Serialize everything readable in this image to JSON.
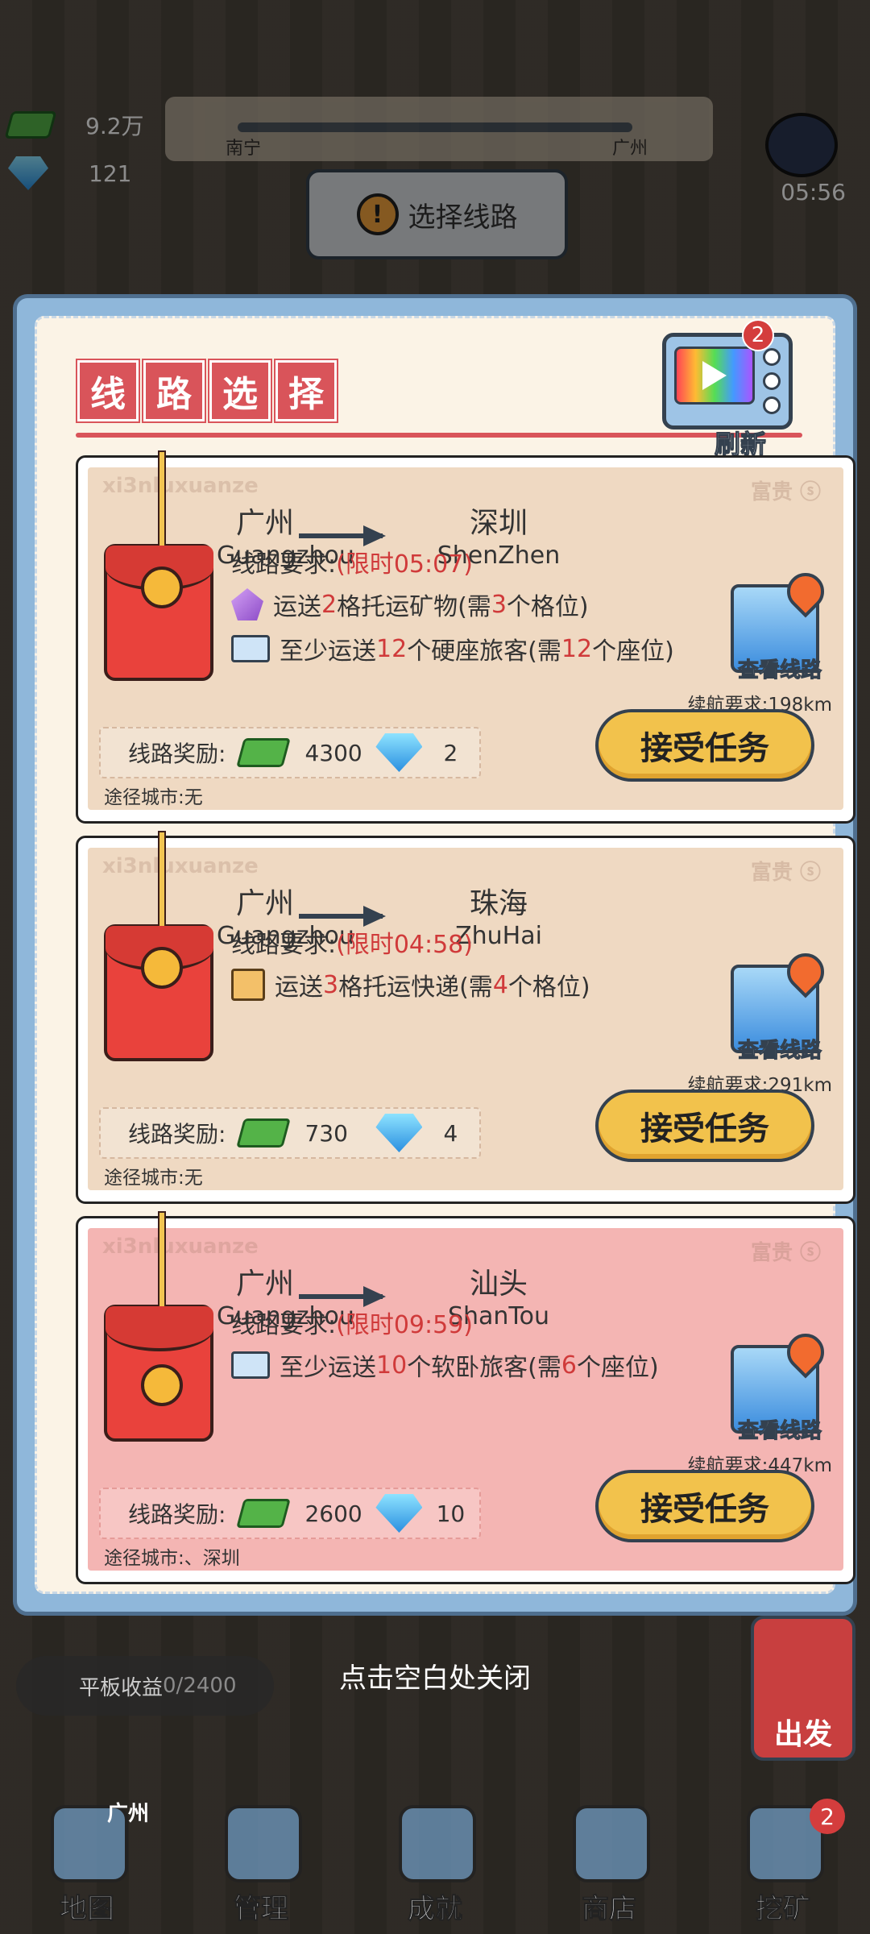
{
  "hud": {
    "cash": "9.2万",
    "gems": "121",
    "route_from": "南宁",
    "route_to": "广州",
    "timer": "05:56",
    "select_route_label": "选择线路"
  },
  "panel": {
    "title_chars": [
      "线",
      "路",
      "选",
      "择"
    ],
    "refresh_label": "刷新",
    "refresh_badge": "2",
    "watermark_left": "xi3nluxuanze",
    "watermark_right": "富贵 ⓢ"
  },
  "cards": [
    {
      "from_cn": "广州",
      "from_en": "Guangzhou",
      "to_cn": "深圳",
      "to_en": "ShenZhen",
      "requirement_label": "线路要求:",
      "time_limit": "(限时05:07)",
      "req1_pre": "运送",
      "req1_num": "2",
      "req1_mid": "格托运矿物(需",
      "req1_need": "3",
      "req1_post": "个格位)",
      "req2_pre": "至少运送",
      "req2_num": "12",
      "req2_mid": "个硬座旅客(需",
      "req2_need": "12",
      "req2_post": "个座位)",
      "map_label": "查看线路",
      "range": "续航要求:198km",
      "reward_label": "线路奖励:",
      "reward_cash": "4300",
      "reward_gems": "2",
      "via": "途径城市:无",
      "accept_label": "接受任务"
    },
    {
      "from_cn": "广州",
      "from_en": "Guangzhou",
      "to_cn": "珠海",
      "to_en": "ZhuHai",
      "requirement_label": "线路要求:",
      "time_limit": "(限时04:58)",
      "req1_pre": "运送",
      "req1_num": "3",
      "req1_mid": "格托运快递(需",
      "req1_need": "4",
      "req1_post": "个格位)",
      "map_label": "查看线路",
      "range": "续航要求:291km",
      "reward_label": "线路奖励:",
      "reward_cash": "730",
      "reward_gems": "4",
      "via": "途径城市:无",
      "accept_label": "接受任务"
    },
    {
      "from_cn": "广州",
      "from_en": "Guangzhou",
      "to_cn": "汕头",
      "to_en": "ShanTou",
      "requirement_label": "线路要求:",
      "time_limit": "(限时09:59)",
      "req1_pre": "至少运送",
      "req1_num": "10",
      "req1_mid": "个软卧旅客(需",
      "req1_need": "6",
      "req1_post": "个座位)",
      "map_label": "查看线路",
      "range": "续航要求:447km",
      "reward_label": "线路奖励:",
      "reward_cash": "2600",
      "reward_gems": "10",
      "via": "途径城市:、深圳",
      "accept_label": "接受任务"
    }
  ],
  "bottom": {
    "close_hint": "点击空白处关闭",
    "tablet_label": "平板收益",
    "tablet_progress": "0/2400",
    "depart_label": "出发",
    "nav": [
      "地图",
      "管理",
      "成就",
      "商店",
      "挖矿"
    ],
    "map_city": "广州",
    "mine_badge": "2"
  }
}
